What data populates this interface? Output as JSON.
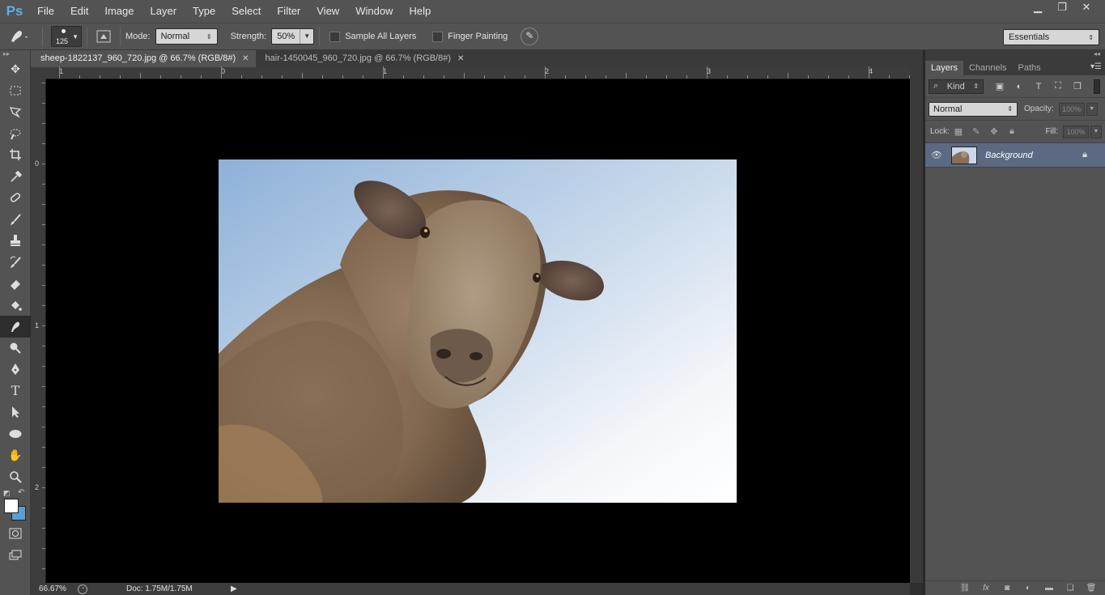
{
  "app": {
    "logo": "Ps"
  },
  "menu": [
    "File",
    "Edit",
    "Image",
    "Layer",
    "Type",
    "Select",
    "Filter",
    "View",
    "Window",
    "Help"
  ],
  "window_controls": {
    "minimize": "▁",
    "restore": "❐",
    "close": "✕"
  },
  "options": {
    "brush_size": "125",
    "mode_label": "Mode:",
    "mode_value": "Normal",
    "strength_label": "Strength:",
    "strength_value": "50%",
    "sample_all_layers": "Sample All Layers",
    "finger_painting": "Finger Painting",
    "workspace": "Essentials"
  },
  "tabs": [
    {
      "label": "sheep-1822137_960_720.jpg @ 66.7% (RGB/8#)",
      "active": true
    },
    {
      "label": "hair-1450045_960_720.jpg @ 66.7% (RGB/8#)",
      "active": false
    }
  ],
  "ruler": {
    "top_labels": [
      "1",
      "0",
      "1",
      "2",
      "3",
      "4"
    ],
    "left_labels": [
      "0",
      "1",
      "2"
    ]
  },
  "status": {
    "zoom": "66.67%",
    "doc": "Doc: 1.75M/1.75M"
  },
  "panel": {
    "tabs": [
      "Layers",
      "Channels",
      "Paths"
    ],
    "kind": "Kind",
    "blend": "Normal",
    "opacity_label": "Opacity:",
    "opacity_value": "100%",
    "lock_label": "Lock:",
    "fill_label": "Fill:",
    "fill_value": "100%",
    "layer_name": "Background"
  },
  "colors": {
    "foreground": "#ffffff",
    "background": "#5b9fd2",
    "ui_panel": "#535353",
    "layer_selected": "#5b6a82"
  }
}
